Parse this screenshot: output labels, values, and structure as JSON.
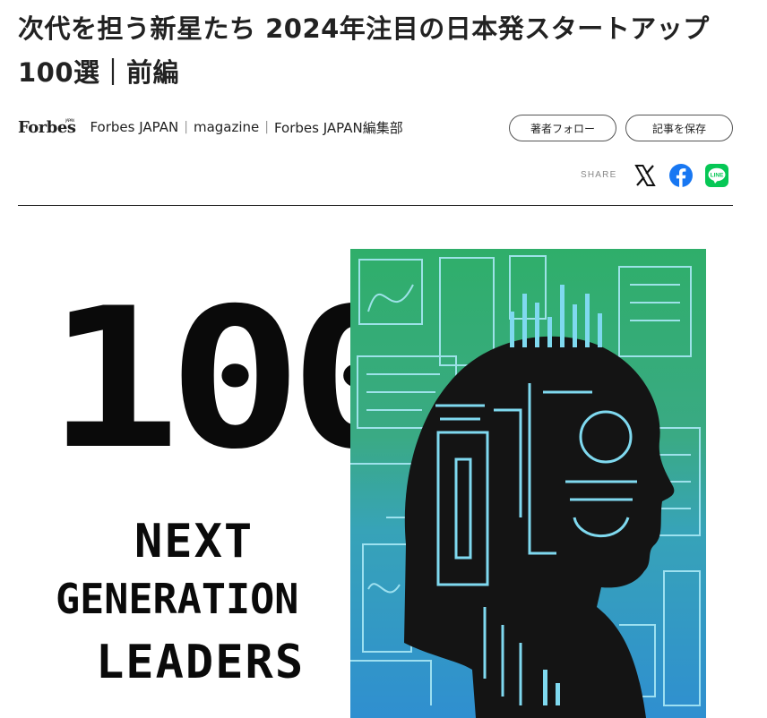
{
  "article": {
    "title": "次代を担う新星たち 2024年注目の日本発スタートアップ100選｜前編"
  },
  "byline": {
    "logo_text": "Forbes",
    "logo_sup": "JAPAN",
    "publication": "Forbes JAPAN",
    "section": "magazine",
    "author": "Forbes JAPAN編集部"
  },
  "actions": {
    "follow_label": "著者フォロー",
    "save_label": "記事を保存"
  },
  "share": {
    "label": "SHARE",
    "icons": [
      "x-icon",
      "facebook-icon",
      "line-icon"
    ],
    "line_text": "LINE"
  },
  "hero": {
    "number": "100",
    "line1": "NEXT",
    "line2": "GENERATION",
    "line3": "LEADERS"
  },
  "colors": {
    "facebook": "#1877f2",
    "line": "#06c755",
    "illustration_green": "#2fae6a",
    "illustration_blue": "#2f8fd0"
  }
}
